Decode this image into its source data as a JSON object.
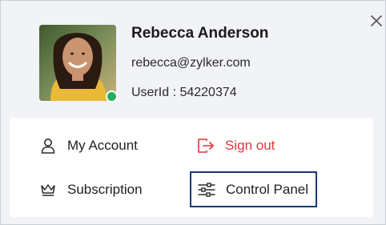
{
  "profile": {
    "name": "Rebecca Anderson",
    "email": "rebecca@zylker.com",
    "user_id": "UserId : 54220374",
    "presence_status": "online",
    "presence_color": "#1fae63"
  },
  "menu": {
    "my_account": {
      "label": "My Account",
      "icon": "person-icon"
    },
    "sign_out": {
      "label": "Sign out",
      "icon": "sign-out-icon",
      "color": "#e0363c"
    },
    "subscription": {
      "label": "Subscription",
      "icon": "crown-icon"
    },
    "control_panel": {
      "label": "Control Panel",
      "icon": "sliders-icon",
      "focused": true,
      "focus_color": "#163a78"
    }
  },
  "close": {
    "icon": "close-icon"
  }
}
